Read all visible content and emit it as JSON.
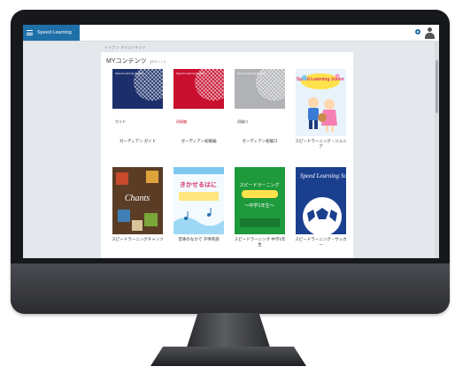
{
  "header": {
    "brand": "Speed Learning",
    "breadcrumb": "トップ ＞ マイコンテンツ"
  },
  "main": {
    "title": "MYコンテンツ",
    "subtitle": "全8タイトル"
  },
  "cards": [
    {
      "label": "ガーディアン ガイド",
      "cover_top_text": "Speed Learning English",
      "cover_caption": "ガイド",
      "cover_color": "#1d2f6b"
    },
    {
      "label": "ガーディアン初級編",
      "cover_top_text": "Speed Learning English",
      "cover_caption": "初級編",
      "cover_color": "#c8102e"
    },
    {
      "label": "ガーディアン初級ロ",
      "cover_top_text": "Speed Learning English",
      "cover_caption": "初級ロ",
      "cover_color": "#b0b2b5"
    },
    {
      "label": "スピードラーニング・ジュニア",
      "cover_title": "Speed Learning Junior",
      "cover_color": "#e9f3fb"
    },
    {
      "label": "スピードラーニングチャンツ",
      "cover_title": "Chants",
      "cover_color": "#6b4a30"
    },
    {
      "label": "音楽のなかで 子供英語",
      "cover_title": "きかせるはに",
      "cover_color": "#ffffff"
    },
    {
      "label": "スピードラーニング 中学1年生",
      "cover_title": "スピードラーニング",
      "cover_sub": "～中学1年生～",
      "cover_color": "#1e9a3c"
    },
    {
      "label": "スピードラーニング・サッカー",
      "cover_title": "Speed Learning Soccer",
      "cover_color": "#1b3f8f"
    }
  ],
  "icons": [
    "menu-icon",
    "gear-icon",
    "user-icon"
  ],
  "colors": {
    "brand": "#1f6fa8",
    "background": "#e4e7ec"
  }
}
